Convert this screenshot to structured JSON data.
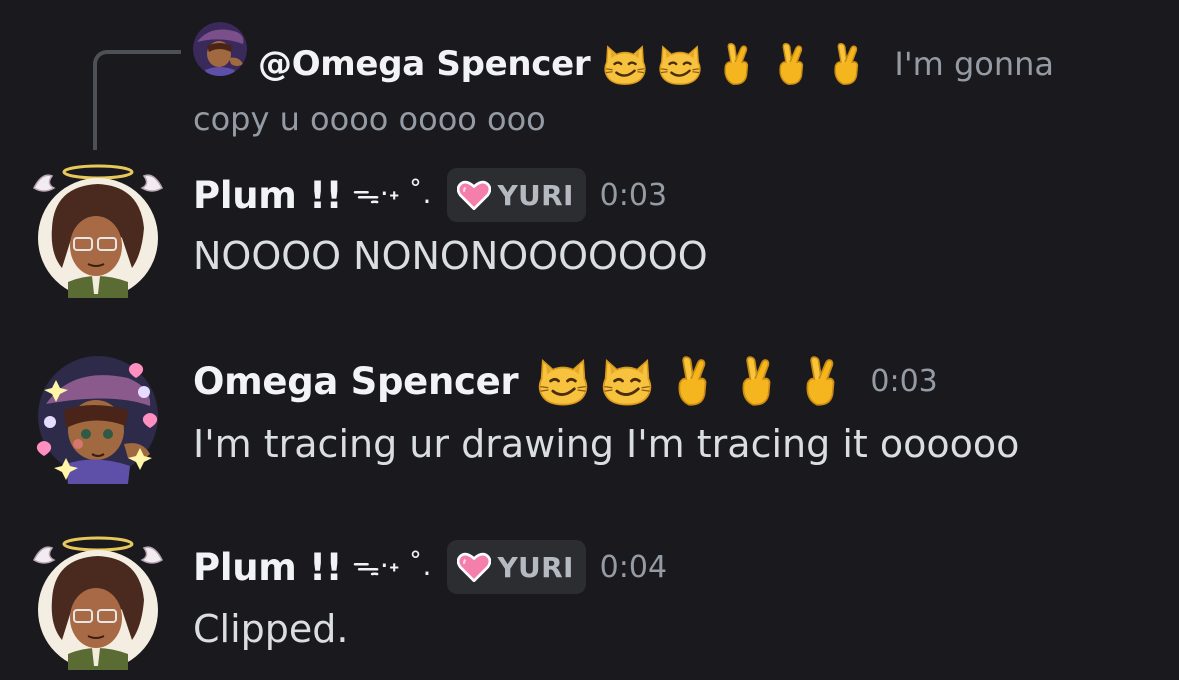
{
  "reply": {
    "author": "@Omega Spencer",
    "emojis": [
      "smirk-cat-emoji",
      "smirk-cat-emoji",
      "crossed-fingers-emoji",
      "crossed-fingers-emoji",
      "crossed-fingers-emoji"
    ],
    "preview_line1": "I'm gonna",
    "preview_line2": "copy u oooo oooo ooo"
  },
  "messages": [
    {
      "author": "Plum !!",
      "decoration": "ᯓ·˖ ˚.",
      "tag": "YURI",
      "time": "0:03",
      "text": "NOOOO NONONOOOOOOO"
    },
    {
      "author": "Omega Spencer",
      "emojis": [
        "smirk-cat-emoji",
        "smirk-cat-emoji",
        "crossed-fingers-emoji",
        "crossed-fingers-emoji",
        "crossed-fingers-emoji"
      ],
      "time": "0:03",
      "text": "I'm tracing ur drawing I'm tracing it oooooo"
    },
    {
      "author": "Plum !!",
      "decoration": "ᯓ·˖ ˚.",
      "tag": "YURI",
      "time": "0:04",
      "text": "Clipped."
    }
  ],
  "colors": {
    "background": "#1a1a1e",
    "username": "#f2f3f5",
    "muted": "#949ba4",
    "tag_bg": "#2b2d31",
    "heart": "#f47fab"
  }
}
